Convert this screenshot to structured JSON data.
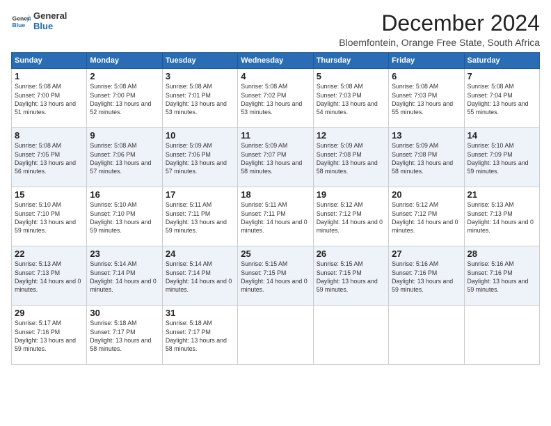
{
  "logo": {
    "line1": "General",
    "line2": "Blue"
  },
  "title": "December 2024",
  "subtitle": "Bloemfontein, Orange Free State, South Africa",
  "weekdays": [
    "Sunday",
    "Monday",
    "Tuesday",
    "Wednesday",
    "Thursday",
    "Friday",
    "Saturday"
  ],
  "weeks": [
    [
      {
        "day": 1,
        "sunrise": "5:08 AM",
        "sunset": "7:00 PM",
        "daylight": "13 hours and 51 minutes."
      },
      {
        "day": 2,
        "sunrise": "5:08 AM",
        "sunset": "7:00 PM",
        "daylight": "13 hours and 52 minutes."
      },
      {
        "day": 3,
        "sunrise": "5:08 AM",
        "sunset": "7:01 PM",
        "daylight": "13 hours and 53 minutes."
      },
      {
        "day": 4,
        "sunrise": "5:08 AM",
        "sunset": "7:02 PM",
        "daylight": "13 hours and 53 minutes."
      },
      {
        "day": 5,
        "sunrise": "5:08 AM",
        "sunset": "7:03 PM",
        "daylight": "13 hours and 54 minutes."
      },
      {
        "day": 6,
        "sunrise": "5:08 AM",
        "sunset": "7:03 PM",
        "daylight": "13 hours and 55 minutes."
      },
      {
        "day": 7,
        "sunrise": "5:08 AM",
        "sunset": "7:04 PM",
        "daylight": "13 hours and 55 minutes."
      }
    ],
    [
      {
        "day": 8,
        "sunrise": "5:08 AM",
        "sunset": "7:05 PM",
        "daylight": "13 hours and 56 minutes."
      },
      {
        "day": 9,
        "sunrise": "5:08 AM",
        "sunset": "7:06 PM",
        "daylight": "13 hours and 57 minutes."
      },
      {
        "day": 10,
        "sunrise": "5:09 AM",
        "sunset": "7:06 PM",
        "daylight": "13 hours and 57 minutes."
      },
      {
        "day": 11,
        "sunrise": "5:09 AM",
        "sunset": "7:07 PM",
        "daylight": "13 hours and 58 minutes."
      },
      {
        "day": 12,
        "sunrise": "5:09 AM",
        "sunset": "7:08 PM",
        "daylight": "13 hours and 58 minutes."
      },
      {
        "day": 13,
        "sunrise": "5:09 AM",
        "sunset": "7:08 PM",
        "daylight": "13 hours and 58 minutes."
      },
      {
        "day": 14,
        "sunrise": "5:10 AM",
        "sunset": "7:09 PM",
        "daylight": "13 hours and 59 minutes."
      }
    ],
    [
      {
        "day": 15,
        "sunrise": "5:10 AM",
        "sunset": "7:10 PM",
        "daylight": "13 hours and 59 minutes."
      },
      {
        "day": 16,
        "sunrise": "5:10 AM",
        "sunset": "7:10 PM",
        "daylight": "13 hours and 59 minutes."
      },
      {
        "day": 17,
        "sunrise": "5:11 AM",
        "sunset": "7:11 PM",
        "daylight": "13 hours and 59 minutes."
      },
      {
        "day": 18,
        "sunrise": "5:11 AM",
        "sunset": "7:11 PM",
        "daylight": "14 hours and 0 minutes."
      },
      {
        "day": 19,
        "sunrise": "5:12 AM",
        "sunset": "7:12 PM",
        "daylight": "14 hours and 0 minutes."
      },
      {
        "day": 20,
        "sunrise": "5:12 AM",
        "sunset": "7:12 PM",
        "daylight": "14 hours and 0 minutes."
      },
      {
        "day": 21,
        "sunrise": "5:13 AM",
        "sunset": "7:13 PM",
        "daylight": "14 hours and 0 minutes."
      }
    ],
    [
      {
        "day": 22,
        "sunrise": "5:13 AM",
        "sunset": "7:13 PM",
        "daylight": "14 hours and 0 minutes."
      },
      {
        "day": 23,
        "sunrise": "5:14 AM",
        "sunset": "7:14 PM",
        "daylight": "14 hours and 0 minutes."
      },
      {
        "day": 24,
        "sunrise": "5:14 AM",
        "sunset": "7:14 PM",
        "daylight": "14 hours and 0 minutes."
      },
      {
        "day": 25,
        "sunrise": "5:15 AM",
        "sunset": "7:15 PM",
        "daylight": "14 hours and 0 minutes."
      },
      {
        "day": 26,
        "sunrise": "5:15 AM",
        "sunset": "7:15 PM",
        "daylight": "13 hours and 59 minutes."
      },
      {
        "day": 27,
        "sunrise": "5:16 AM",
        "sunset": "7:16 PM",
        "daylight": "13 hours and 59 minutes."
      },
      {
        "day": 28,
        "sunrise": "5:16 AM",
        "sunset": "7:16 PM",
        "daylight": "13 hours and 59 minutes."
      }
    ],
    [
      {
        "day": 29,
        "sunrise": "5:17 AM",
        "sunset": "7:16 PM",
        "daylight": "13 hours and 59 minutes."
      },
      {
        "day": 30,
        "sunrise": "5:18 AM",
        "sunset": "7:17 PM",
        "daylight": "13 hours and 58 minutes."
      },
      {
        "day": 31,
        "sunrise": "5:18 AM",
        "sunset": "7:17 PM",
        "daylight": "13 hours and 58 minutes."
      },
      null,
      null,
      null,
      null
    ]
  ]
}
